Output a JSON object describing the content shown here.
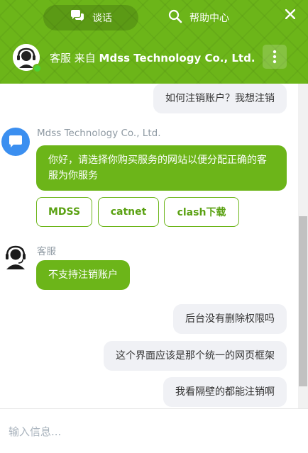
{
  "header": {
    "tabs": [
      {
        "label": "谈话",
        "icon": "chat-bubbles-icon",
        "active": true
      },
      {
        "label": "帮助中心",
        "icon": "search-icon",
        "active": false
      }
    ],
    "close_icon": "close-icon",
    "agent_prefix": "客服 来自 ",
    "agent_company": "Mdss Technology Co., Ltd.",
    "more_icon": "more-vertical-icon",
    "online_status_color": "#4cd137"
  },
  "theme": {
    "accent": "#6cb519",
    "outgoing_bubble": "#f0f1f5",
    "bot_avatar": "#3b8ff0"
  },
  "messages": {
    "m1": {
      "direction": "out",
      "text": "如何注销账户？我想注销"
    },
    "m2": {
      "direction": "in",
      "sender": "Mdss Technology Co., Ltd.",
      "text": "你好，请选择你购买服务的网站以便分配正确的客服为你服务"
    },
    "quick_replies": [
      "MDSS",
      "catnet",
      "clash下载"
    ],
    "m3": {
      "direction": "in",
      "sender": "客服",
      "text": "不支持注销账户"
    },
    "m4": {
      "direction": "out",
      "text": "后台没有删除权限吗"
    },
    "m5": {
      "direction": "out",
      "text": "这个界面应该是那个统一的网页框架"
    },
    "m6": {
      "direction": "out",
      "text": "我看隔壁的都能注销啊"
    }
  },
  "input": {
    "placeholder": "输入信息...",
    "value": ""
  }
}
